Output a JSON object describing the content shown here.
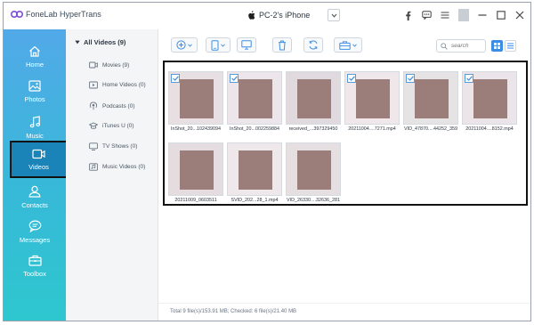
{
  "app": {
    "name": "FoneLab HyperTrans",
    "device": "PC-2's iPhone"
  },
  "colors": {
    "sidebar_top": "#52a9e8",
    "sidebar_bottom": "#2ec7cf",
    "accent": "#3b8ee6",
    "active_nav": "#1a83b8"
  },
  "sidebar": {
    "items": [
      {
        "label": "Home",
        "icon": "home-icon"
      },
      {
        "label": "Photos",
        "icon": "photos-icon"
      },
      {
        "label": "Music",
        "icon": "music-icon"
      },
      {
        "label": "Videos",
        "icon": "video-icon",
        "active": true
      },
      {
        "label": "Contacts",
        "icon": "contacts-icon"
      },
      {
        "label": "Messages",
        "icon": "messages-icon"
      },
      {
        "label": "Toolbox",
        "icon": "toolbox-icon"
      }
    ]
  },
  "categories": {
    "header": "All Videos (9)",
    "items": [
      {
        "label": "Movies (9)",
        "icon": "movie-icon"
      },
      {
        "label": "Home Videos (0)",
        "icon": "home-video-icon"
      },
      {
        "label": "Podcasts (0)",
        "icon": "podcast-icon"
      },
      {
        "label": "iTunes U (0)",
        "icon": "itunes-u-icon"
      },
      {
        "label": "TV Shows (0)",
        "icon": "tv-icon"
      },
      {
        "label": "Music Videos (0)",
        "icon": "music-video-icon"
      }
    ]
  },
  "search": {
    "placeholder": "search"
  },
  "files": [
    {
      "name": "InShot_20...102439094",
      "checked": true
    },
    {
      "name": "InShot_20...002259884",
      "checked": true
    },
    {
      "name": "received_...397329450",
      "checked": false
    },
    {
      "name": "20211004....7271.mp4",
      "checked": true
    },
    {
      "name": "VID_47870....44252_359",
      "checked": true
    },
    {
      "name": "20211004....8152.mp4",
      "checked": true
    },
    {
      "name": "20211009_0603511",
      "checked": false
    },
    {
      "name": "SVID_202...28_1.mp4",
      "checked": false
    },
    {
      "name": "VID_26330....32636_281",
      "checked": false
    }
  ],
  "status": {
    "text": "Total 9 file(s)/153.91 MB; Checked: 6 file(s)/21.40 MB"
  }
}
